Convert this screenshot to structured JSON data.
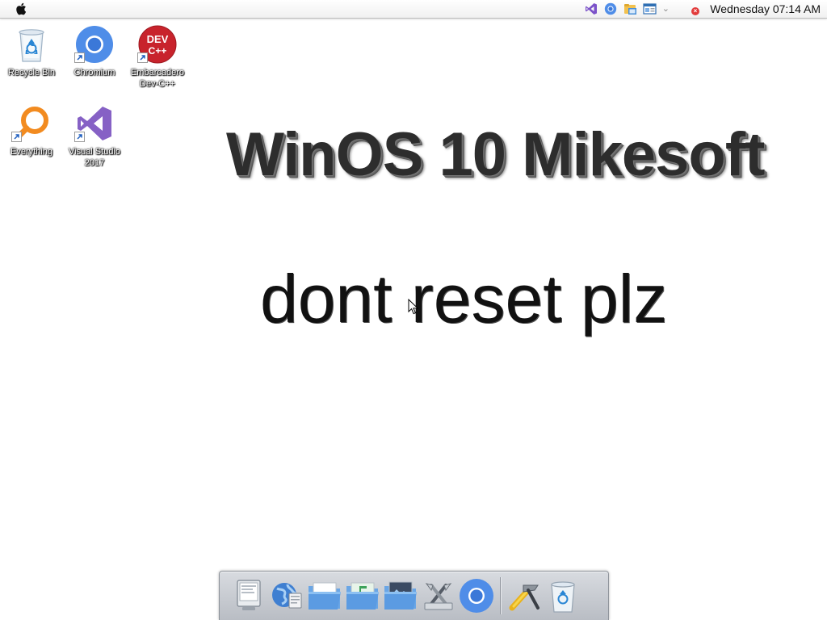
{
  "menubar": {
    "apple_menu": "apple-icon",
    "tray_icons": [
      "visual-studio-tray-icon",
      "chromium-tray-icon",
      "file-explorer-tray-icon",
      "window-tray-icon"
    ],
    "tray_expand": "⌄",
    "clock": "Wednesday 07:14 AM"
  },
  "desktop": {
    "icons": [
      {
        "label": "Recycle Bin",
        "icon": "recycle-bin-icon"
      },
      {
        "label": "Chromium",
        "icon": "chromium-icon"
      },
      {
        "label": "Embarcadero\nDev-C++",
        "icon": "dev-cpp-icon",
        "badge": "DEV\nC++"
      },
      {
        "label": "Everything",
        "icon": "everything-search-icon"
      },
      {
        "label": "Visual Studio\n2017",
        "icon": "visual-studio-icon"
      }
    ]
  },
  "wallpaper": {
    "title": "WinOS 10 Mikesoft",
    "subtitle": "dont reset plz"
  },
  "dock": {
    "items": [
      "finder-icon",
      "network-globe-icon",
      "documents-folder-icon",
      "music-folder-icon",
      "pictures-folder-icon",
      "utilities-icon",
      "chromium-icon",
      "system-tools-icon",
      "recycle-bin-icon"
    ]
  },
  "colors": {
    "chromium_blue": "#4f8de8",
    "vs_purple": "#8661c5",
    "dev_red": "#c8232c",
    "everything_orange": "#f28b20"
  }
}
